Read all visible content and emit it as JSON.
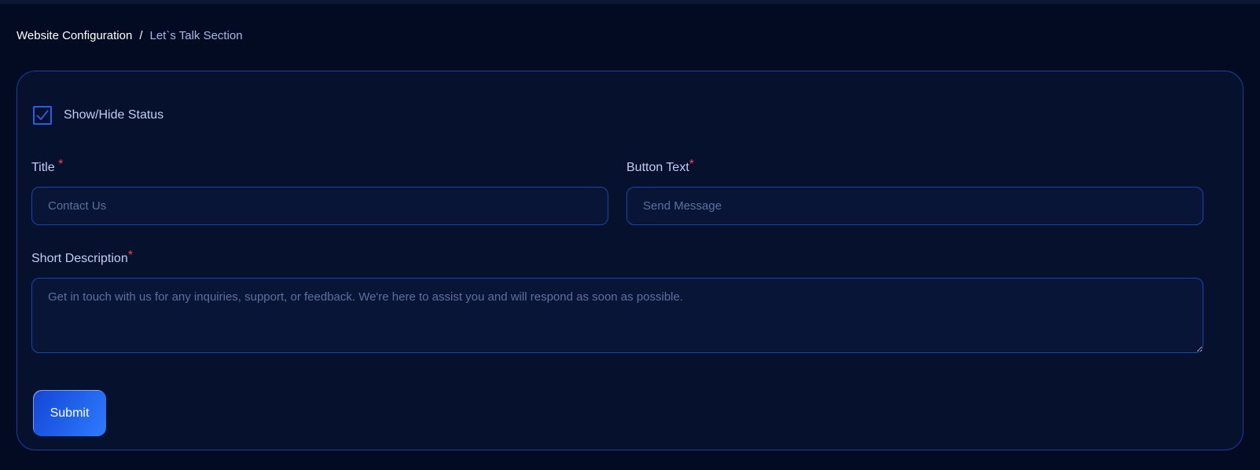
{
  "breadcrumb": {
    "root": "Website Configuration",
    "separator": "/",
    "current": "Let`s Talk Section"
  },
  "form": {
    "show_hide": {
      "label": "Show/Hide Status",
      "checked": true
    },
    "title": {
      "label": "Title",
      "required_mark": "*",
      "placeholder": "Contact Us"
    },
    "button_text": {
      "label": "Button Text",
      "required_mark": "*",
      "placeholder": "Send Message"
    },
    "short_description": {
      "label": "Short Description",
      "required_mark": "*",
      "placeholder": "Get in touch with us for any inquiries, support, or feedback. We're here to assist you and will respond as soon as possible."
    },
    "submit_label": "Submit"
  },
  "icons": {
    "checkbox": "check-icon"
  },
  "colors": {
    "background": "#020b22",
    "card": "#06112e",
    "accent": "#2a5ee6",
    "required": "#ff3b4e",
    "label": "#c2cdf2"
  }
}
